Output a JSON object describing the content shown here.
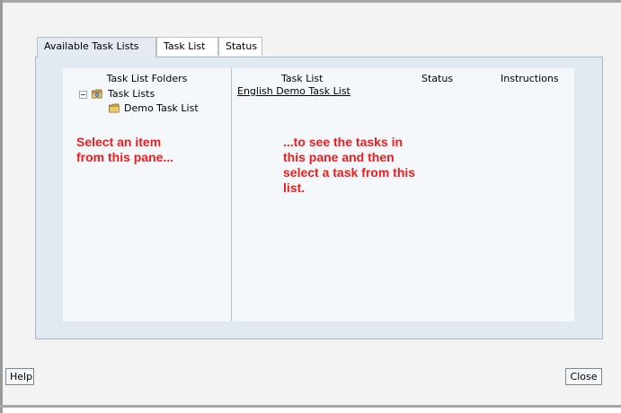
{
  "tabs": [
    {
      "label": "Available Task Lists",
      "active": true
    },
    {
      "label": "Task List",
      "active": false
    },
    {
      "label": "Status",
      "active": false
    }
  ],
  "tree": {
    "header": "Task List Folders",
    "root": {
      "label": "Task Lists",
      "icon": "open-folder-icon",
      "expanded": true
    },
    "children": [
      {
        "label": "Demo Task List",
        "icon": "folder-icon"
      }
    ]
  },
  "task_table": {
    "columns": [
      "Task List",
      "Status",
      "Instructions"
    ],
    "rows": [
      {
        "task_list": "English Demo Task List",
        "status": "",
        "instructions": ""
      }
    ]
  },
  "annotations": {
    "left": [
      "Select an item",
      "from this pane..."
    ],
    "right": [
      "...to see the tasks in",
      "this pane and then",
      "select a task from this",
      "list."
    ],
    "color": "#ee1c1c"
  },
  "buttons": {
    "help": "Help",
    "close": "Close"
  }
}
